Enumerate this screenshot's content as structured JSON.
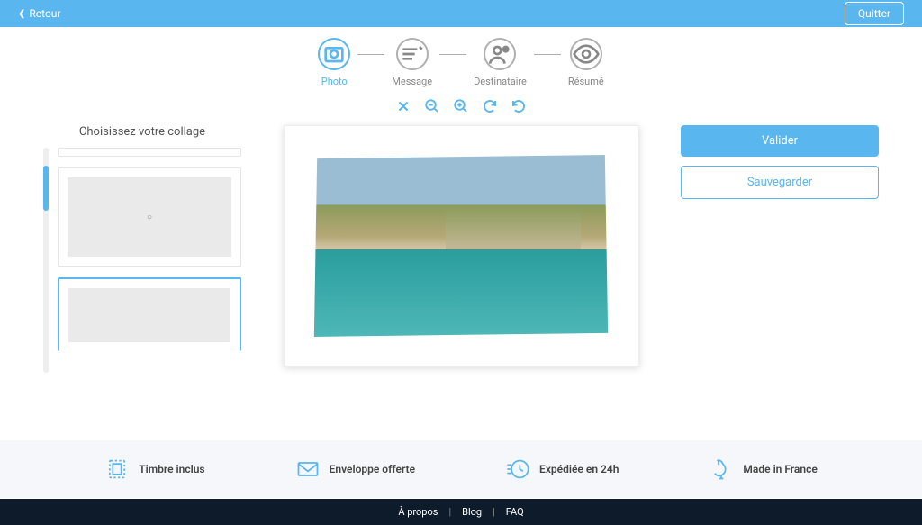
{
  "header": {
    "back": "Retour",
    "quit": "Quitter"
  },
  "steps": [
    {
      "label": "Photo",
      "active": true
    },
    {
      "label": "Message",
      "active": false
    },
    {
      "label": "Destinataire",
      "active": false
    },
    {
      "label": "Résumé",
      "active": false
    }
  ],
  "sidebar": {
    "title": "Choisissez votre collage"
  },
  "actions": {
    "validate": "Valider",
    "save": "Sauvegarder"
  },
  "features": [
    {
      "label": "Timbre inclus"
    },
    {
      "label": "Enveloppe offerte"
    },
    {
      "label": "Expédiée en 24h"
    },
    {
      "label": "Made in France"
    }
  ],
  "footer": {
    "about": "À propos",
    "blog": "Blog",
    "faq": "FAQ"
  }
}
